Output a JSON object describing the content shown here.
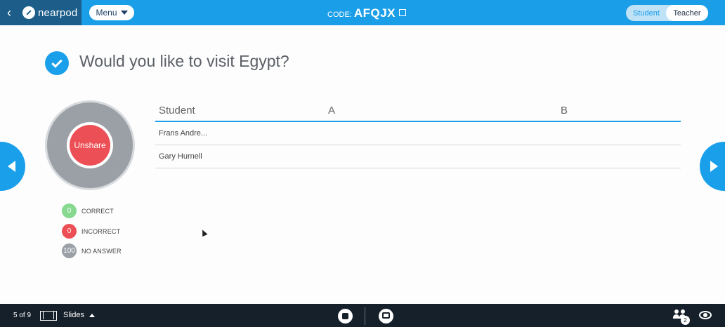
{
  "header": {
    "back_icon": "chevron-left-icon",
    "logo_text": "nearpod",
    "menu_label": "Menu",
    "code_label": "CODE:",
    "code_value": "AFQJX",
    "role_student": "Student",
    "role_teacher": "Teacher",
    "active_role": "Teacher",
    "accent_color": "#1a9ee8",
    "brand_color": "#1c5d8a"
  },
  "question": {
    "text": "Would you like to visit Egypt?"
  },
  "results": {
    "unshare_label": "Unshare",
    "correct_count": "0",
    "correct_label": "CORRECT",
    "correct_color": "#86d98f",
    "incorrect_count": "0",
    "incorrect_label": "INCORRECT",
    "incorrect_color": "#ec4f55",
    "no_answer_count": "100",
    "no_answer_label": "NO ANSWER",
    "no_answer_color": "#9aa0a6"
  },
  "table": {
    "headers": [
      "Student",
      "A",
      "B"
    ],
    "rows": [
      {
        "student": "Frans Andre..."
      },
      {
        "student": "Gary Hurnell"
      }
    ]
  },
  "footer": {
    "page_indicator": "5 of 9",
    "slides_label": "Slides",
    "students_badge": "2"
  }
}
